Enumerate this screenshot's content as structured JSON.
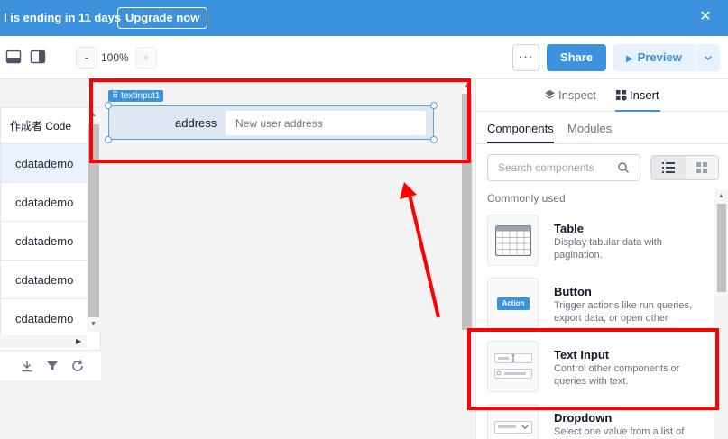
{
  "banner": {
    "text": "l is ending in 11 days",
    "upgrade_label": "Upgrade now",
    "close_icon": "close-icon"
  },
  "toolbar": {
    "zoom_minus": "-",
    "zoom_value": "100%",
    "zoom_plus": "+",
    "more_label": "···",
    "share_label": "Share",
    "preview_label": "Preview",
    "preview_caret": "⌄",
    "icons": [
      "layout-bottom-panel-icon",
      "layout-right-panel-icon"
    ]
  },
  "table": {
    "column_header": "作成者 Code",
    "rows": [
      "cdatademo",
      "cdatademo",
      "cdatademo",
      "cdatademo",
      "cdatademo"
    ],
    "footer_icons": [
      "download-icon",
      "filter-icon",
      "refresh-icon"
    ]
  },
  "canvas": {
    "component_badge": "⠿ textinput1",
    "input_label": "address",
    "input_placeholder": "New user address"
  },
  "right_panel": {
    "tabs": [
      {
        "label": "Inspect",
        "icon": "layers-icon"
      },
      {
        "label": "Insert",
        "icon": "insert-component-icon"
      }
    ],
    "subtabs": [
      "Components",
      "Modules"
    ],
    "search_placeholder": "Search components",
    "section_title": "Commonly used",
    "components": [
      {
        "name": "Table",
        "description": "Display tabular data with pagination.",
        "icon": "table-icon"
      },
      {
        "name": "Button",
        "description": "Trigger actions like run queries, export data, or open other",
        "icon": "button-icon",
        "badge": "Action"
      },
      {
        "name": "Text Input",
        "description": "Control other components or queries with text.",
        "icon": "text-input-icon"
      },
      {
        "name": "Dropdown",
        "description": "Select one value from a list of",
        "icon": "dropdown-icon"
      }
    ]
  },
  "colors": {
    "accent": "#3c92dc",
    "annotation": "#ff0000"
  }
}
